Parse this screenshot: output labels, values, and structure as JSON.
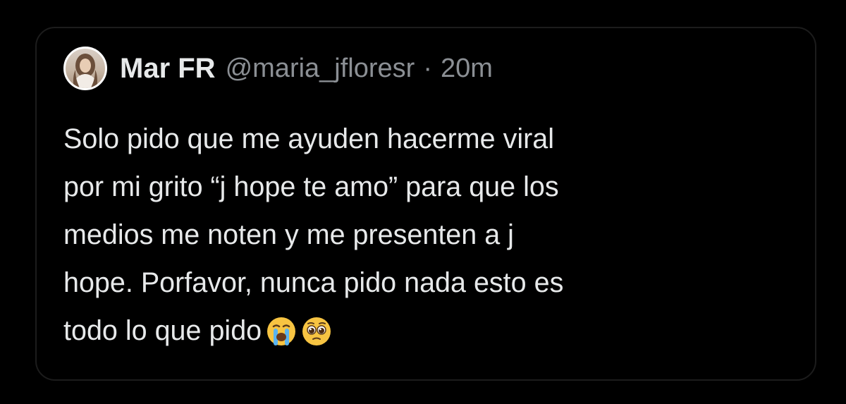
{
  "tweet": {
    "author": {
      "display_name": "Mar FR",
      "handle": "@maria_jfloresr",
      "avatar_icon": "profile-photo"
    },
    "separator": "·",
    "time": "20m",
    "text_lines": [
      "Solo pido que me ayuden hacerme viral",
      "por mi grito “j hope te amo” para que los",
      "medios me noten y me presenten a j",
      "hope. Porfavor, nunca pido nada esto es",
      "todo lo que pido"
    ],
    "emojis": [
      "loudly-crying-face-icon",
      "pleading-face-icon"
    ]
  },
  "colors": {
    "background": "#000000",
    "primary_text": "#e7e9ea",
    "secondary_text": "#8b8f94"
  }
}
